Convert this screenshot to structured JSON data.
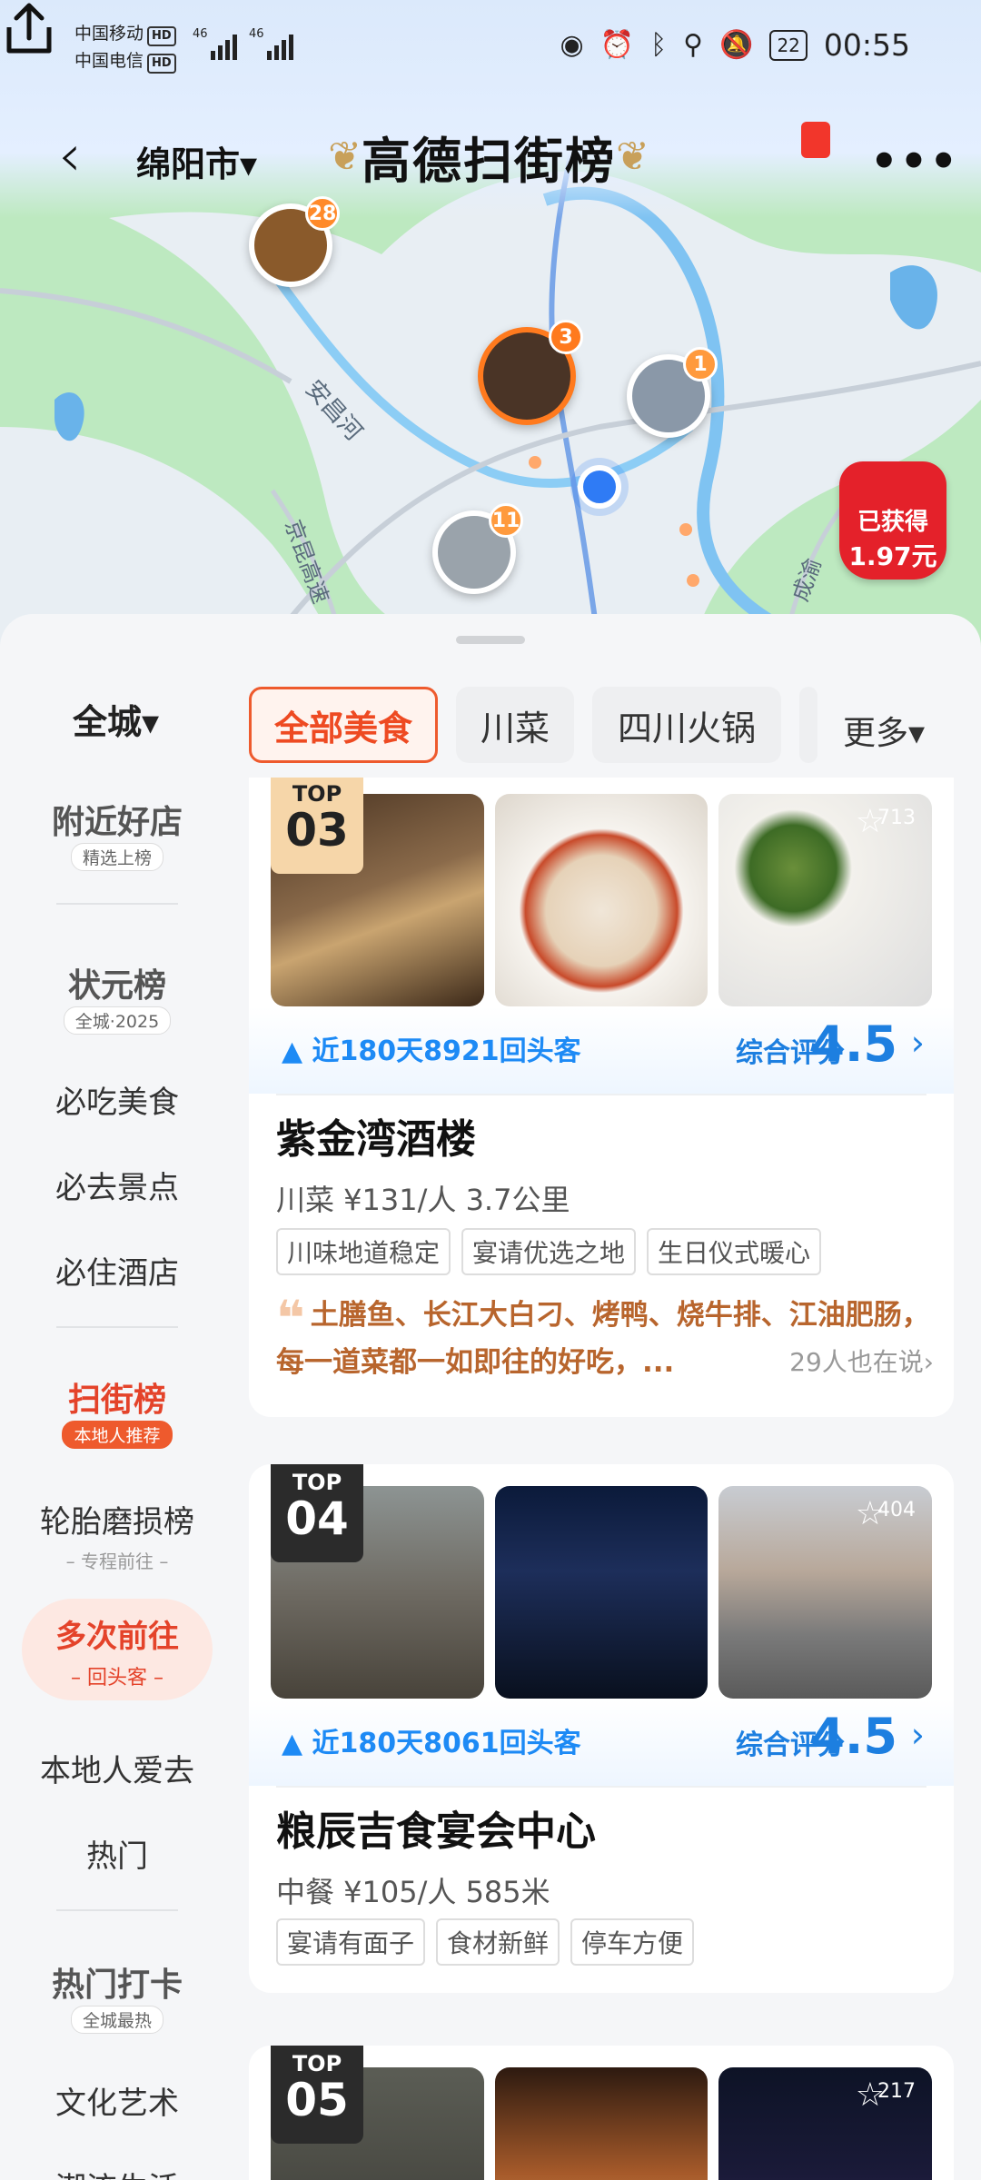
{
  "status_bar": {
    "carrier1": "中国移动",
    "carrier2": "中国电信",
    "hd": "HD",
    "net1": "46",
    "net2": "46",
    "battery": "22",
    "time": "00:55"
  },
  "header": {
    "city": "绵阳市▾",
    "title": "高德扫街榜",
    "more": "•••"
  },
  "map": {
    "labels": [
      "安昌河",
      "京昆高速",
      "成渝"
    ],
    "markers": [
      {
        "badge": "28",
        "color": "#ff8a2a"
      },
      {
        "badge": "3",
        "color": "#ff7a1e"
      },
      {
        "badge": "1",
        "color": "#ff9a3d"
      },
      {
        "badge": "11",
        "color": "#ff9a3d"
      }
    ],
    "reward": {
      "line1": "已获得",
      "line2": "1.97元"
    }
  },
  "filters": {
    "scope": "全城▾",
    "chips": [
      "全部美食",
      "川菜",
      "四川火锅"
    ],
    "more": "更多▾"
  },
  "rail": {
    "nearby": {
      "title": "附近好店",
      "sub": "精选上榜"
    },
    "top": {
      "title": "状元榜",
      "sub": "全城·2025"
    },
    "items1": [
      "必吃美食",
      "必去景点",
      "必住酒店"
    ],
    "scan": {
      "title": "扫街榜",
      "sub": "本地人推荐"
    },
    "tire": {
      "title": "轮胎磨损榜",
      "sub": "– 专程前往 –"
    },
    "repeat": {
      "title": "多次前往",
      "sub": "– 回头客 –"
    },
    "items2": [
      "本地人爱去",
      "热门"
    ],
    "hot": {
      "title": "热门打卡",
      "sub": "全城最热"
    },
    "items3": [
      "文化艺术",
      "潮流生活"
    ]
  },
  "cards": [
    {
      "top": "TOP",
      "rank": "03",
      "photo_count": "713",
      "visitors": "近180天8921回头客",
      "score_label": "综合评分",
      "score": "4.5",
      "name": "紫金湾酒楼",
      "sub": "川菜 ¥131/人 3.7公里",
      "tags": [
        "川味地道稳定",
        "宴请优选之地",
        "生日仪式暖心"
      ],
      "quote": "土膳鱼、长江大白刁、烤鸭、烧牛排、江油肥肠，每一道菜都一如即往的好吃，...",
      "quote_count": "29人也在说›"
    },
    {
      "top": "TOP",
      "rank": "04",
      "photo_count": "404",
      "visitors": "近180天8061回头客",
      "score_label": "综合评分",
      "score": "4.5",
      "name": "粮辰吉食宴会中心",
      "sub": "中餐 ¥105/人 585米",
      "tags": [
        "宴请有面子",
        "食材新鲜",
        "停车方便"
      ]
    },
    {
      "top": "TOP",
      "rank": "05",
      "photo_count": "217"
    }
  ]
}
